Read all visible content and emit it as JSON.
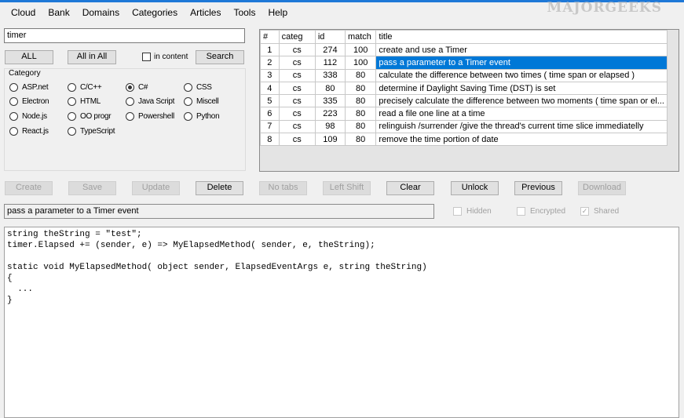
{
  "menu": [
    "Cloud",
    "Bank",
    "Domains",
    "Categories",
    "Articles",
    "Tools",
    "Help"
  ],
  "logo": "MAJORGEEKS .COM",
  "search": {
    "value": "timer",
    "all": "ALL",
    "all_in_all": "All in All",
    "in_content": "in content",
    "search": "Search"
  },
  "category": {
    "label": "Category",
    "options": [
      {
        "label": "ASP.net",
        "checked": false
      },
      {
        "label": "C/C++",
        "checked": false
      },
      {
        "label": "C#",
        "checked": true
      },
      {
        "label": "CSS",
        "checked": false
      },
      {
        "label": "Electron",
        "checked": false
      },
      {
        "label": "HTML",
        "checked": false
      },
      {
        "label": "Java Script",
        "checked": false
      },
      {
        "label": "Miscell",
        "checked": false
      },
      {
        "label": "Node.js",
        "checked": false
      },
      {
        "label": "OO progr",
        "checked": false
      },
      {
        "label": "Powershell",
        "checked": false
      },
      {
        "label": "Python",
        "checked": false
      },
      {
        "label": "React.js",
        "checked": false
      },
      {
        "label": "TypeScript",
        "checked": false
      }
    ]
  },
  "table": {
    "headers": [
      "#",
      "categ",
      "id",
      "match",
      "title"
    ],
    "selected": 1,
    "rows": [
      [
        "1",
        "cs",
        "274",
        "100",
        "create and use a Timer"
      ],
      [
        "2",
        "cs",
        "112",
        "100",
        "pass a parameter to a Timer event"
      ],
      [
        "3",
        "cs",
        "338",
        "80",
        "calculate the difference between two times ( time span or elapsed )"
      ],
      [
        "4",
        "cs",
        "80",
        "80",
        "determine if Daylight Saving Time (DST) is set"
      ],
      [
        "5",
        "cs",
        "335",
        "80",
        "precisely calculate the difference between two moments ( time span or el..."
      ],
      [
        "6",
        "cs",
        "223",
        "80",
        "read a file one line at a time"
      ],
      [
        "7",
        "cs",
        "98",
        "80",
        "relinguish /surrender /give the thread's current time slice immediatelly"
      ],
      [
        "8",
        "cs",
        "109",
        "80",
        "remove the time portion of date"
      ]
    ]
  },
  "actions": [
    {
      "label": "Create",
      "enabled": false
    },
    {
      "label": "Save",
      "enabled": false
    },
    {
      "label": "Update",
      "enabled": false
    },
    {
      "label": "Delete",
      "enabled": true
    },
    {
      "label": "No tabs",
      "enabled": false
    },
    {
      "label": "Left Shift",
      "enabled": false
    },
    {
      "label": "Clear",
      "enabled": true
    },
    {
      "label": "Unlock",
      "enabled": true
    },
    {
      "label": "Previous",
      "enabled": true
    },
    {
      "label": "Download",
      "enabled": false
    }
  ],
  "title_value": "pass a parameter to a Timer event",
  "flags": [
    {
      "label": "Hidden",
      "checked": false
    },
    {
      "label": "Encrypted",
      "checked": false
    },
    {
      "label": "Shared",
      "checked": true
    }
  ],
  "code": "string theString = \"test\";\ntimer.Elapsed += (sender, e) => MyElapsedMethod( sender, e, theString);\n\nstatic void MyElapsedMethod( object sender, ElapsedEventArgs e, string theString)\n{\n  ...\n}"
}
